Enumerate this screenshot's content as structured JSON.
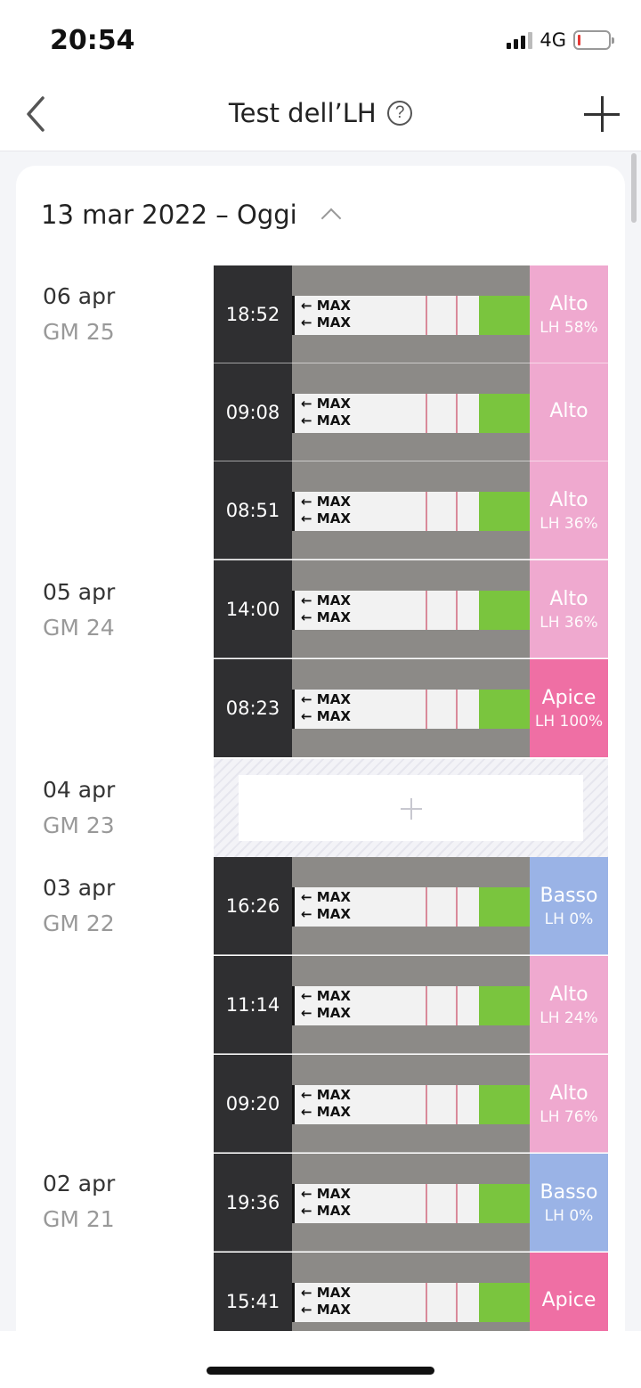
{
  "status": {
    "time": "20:54",
    "network": "4G",
    "icons": [
      "signal-icon",
      "battery-low-icon"
    ]
  },
  "nav": {
    "title": "Test dell’LH",
    "help": "?",
    "icons": [
      "back-arrow-icon",
      "help-icon",
      "plus-icon"
    ]
  },
  "range": {
    "label": "13 mar 2022 – Oggi",
    "icon": "chevron-up-icon"
  },
  "strip_text": "MAX",
  "colors": {
    "alto": "#efa9cf",
    "apice": "#ef6fa4",
    "basso": "#9ab3e6",
    "green_band": "#7ac53e"
  },
  "days": [
    {
      "date": "06 apr",
      "cycle": "GM 25"
    },
    {
      "date": "05 apr",
      "cycle": "GM 24"
    },
    {
      "date": "04 apr",
      "cycle": "GM 23"
    },
    {
      "date": "03 apr",
      "cycle": "GM 22"
    },
    {
      "date": "02 apr",
      "cycle": "GM 21"
    }
  ],
  "tests": [
    {
      "time": "18:52",
      "level": "Alto",
      "lh": "LH 58%"
    },
    {
      "time": "09:08",
      "level": "Alto",
      "lh": ""
    },
    {
      "time": "08:51",
      "level": "Alto",
      "lh": "LH 36%"
    },
    {
      "time": "14:00",
      "level": "Alto",
      "lh": "LH 36%"
    },
    {
      "time": "08:23",
      "level": "Apice",
      "lh": "LH 100%"
    },
    {
      "time": "16:26",
      "level": "Basso",
      "lh": "LH 0%"
    },
    {
      "time": "11:14",
      "level": "Alto",
      "lh": "LH 24%"
    },
    {
      "time": "09:20",
      "level": "Alto",
      "lh": "LH 76%"
    },
    {
      "time": "19:36",
      "level": "Basso",
      "lh": "LH 0%"
    },
    {
      "time": "15:41",
      "level": "Apice",
      "lh": ""
    }
  ],
  "empty_slot": {
    "icon": "plus-icon"
  }
}
